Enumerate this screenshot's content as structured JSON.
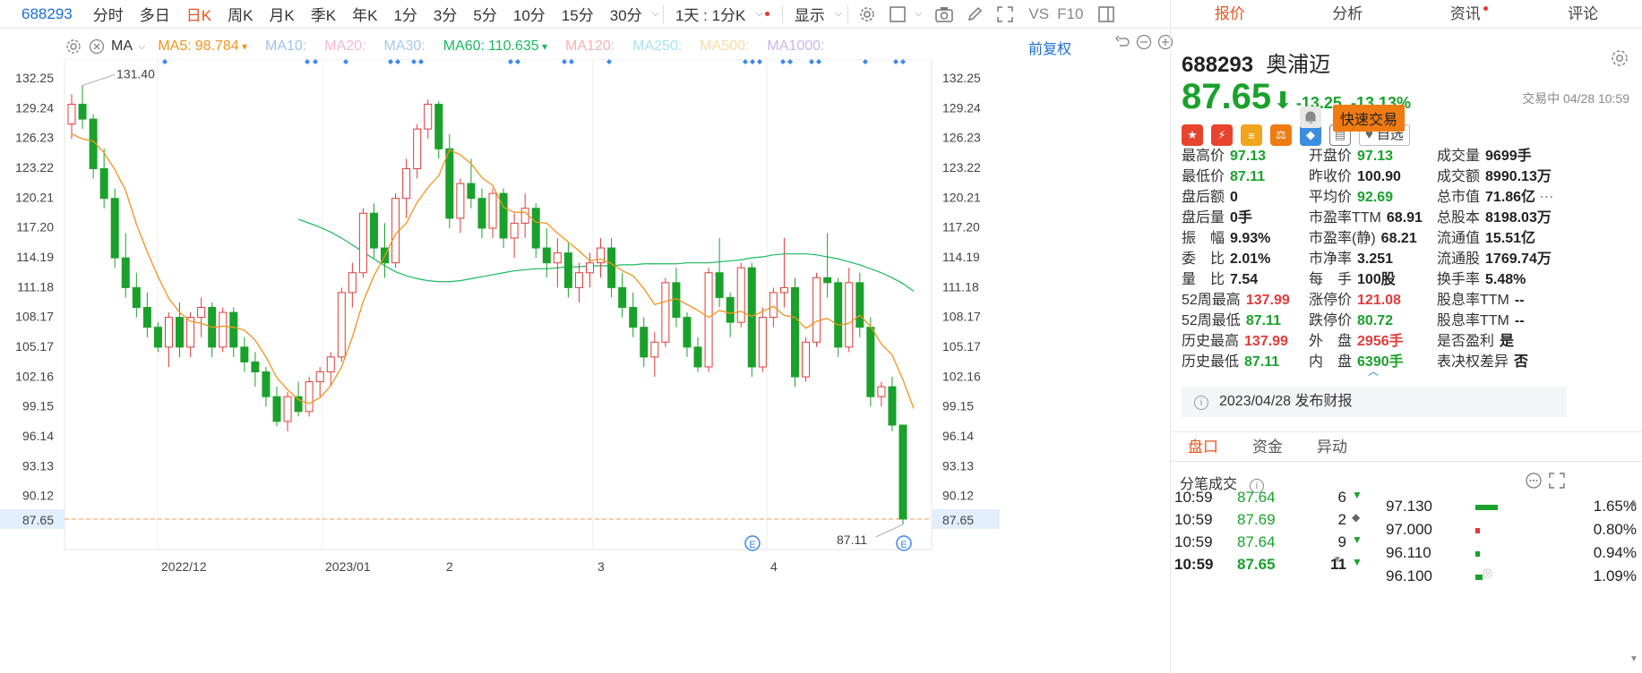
{
  "toolbar": {
    "code": "688293",
    "periods": [
      "分时",
      "多日",
      "日K",
      "周K",
      "月K",
      "季K",
      "年K",
      "1分",
      "3分",
      "5分",
      "10分",
      "15分",
      "30分"
    ],
    "active_period": "日K",
    "range": "1天 : 1分K",
    "display": "显示",
    "vs": "VS",
    "f10": "F10"
  },
  "ma_bar": {
    "indicator": "MA",
    "items": [
      {
        "label": "MA5:",
        "value": "98.784",
        "color": "#f0941c"
      },
      {
        "label": "MA10:",
        "value": "",
        "color": "#9cc3f0"
      },
      {
        "label": "MA20:",
        "value": "",
        "color": "#f6b7cf"
      },
      {
        "label": "MA30:",
        "value": "",
        "color": "#a8c8f0"
      },
      {
        "label": "MA60:",
        "value": "110.635",
        "color": "#1bb85f"
      },
      {
        "label": "MA120:",
        "value": "",
        "color": "#f5b2b2"
      },
      {
        "label": "MA250:",
        "value": "",
        "color": "#a6e3f2"
      },
      {
        "label": "MA500:",
        "value": "",
        "color": "#f6dca2"
      },
      {
        "label": "MA1000:",
        "value": "",
        "color": "#c9b5ea"
      }
    ],
    "fuquan": "前复权"
  },
  "chart_data": {
    "type": "candlestick",
    "y_ticks": [
      "132.25",
      "129.24",
      "126.23",
      "123.22",
      "120.21",
      "117.20",
      "114.19",
      "111.18",
      "108.17",
      "105.17",
      "102.16",
      "99.15",
      "96.14",
      "93.13",
      "90.12",
      "87.65"
    ],
    "ylim": [
      87.65,
      132.25
    ],
    "x_labels": [
      "2022/12",
      "2023/01",
      "2",
      "3",
      "4"
    ],
    "last_price": "87.65",
    "high_annotation": "131.40",
    "low_annotation": "87.11",
    "candles": [
      [
        127.5,
        130.5,
        126.0,
        129.5
      ],
      [
        129.5,
        131.4,
        127.0,
        128.0
      ],
      [
        128.0,
        128.5,
        122.0,
        123.0
      ],
      [
        123.0,
        125.0,
        119.0,
        120.0
      ],
      [
        120.0,
        121.0,
        113.0,
        114.0
      ],
      [
        114.0,
        116.5,
        110.0,
        111.0
      ],
      [
        111.0,
        112.5,
        108.0,
        109.0
      ],
      [
        109.0,
        110.5,
        106.0,
        107.0
      ],
      [
        107.0,
        107.5,
        104.5,
        105.0
      ],
      [
        105.0,
        108.5,
        103.0,
        108.0
      ],
      [
        108.0,
        109.5,
        104.0,
        105.0
      ],
      [
        105.0,
        108.5,
        104.0,
        108.0
      ],
      [
        108.0,
        110.0,
        106.0,
        109.0
      ],
      [
        109.0,
        109.5,
        104.0,
        105.0
      ],
      [
        105.0,
        109.0,
        104.5,
        108.5
      ],
      [
        108.5,
        109.0,
        104.0,
        105.0
      ],
      [
        105.0,
        106.0,
        102.5,
        103.5
      ],
      [
        103.5,
        104.5,
        101.0,
        102.5
      ],
      [
        102.5,
        103.0,
        99.0,
        100.0
      ],
      [
        100.0,
        101.0,
        97.0,
        97.5
      ],
      [
        97.5,
        100.5,
        96.5,
        100.0
      ],
      [
        100.0,
        101.5,
        98.0,
        98.5
      ],
      [
        98.5,
        102.0,
        98.0,
        101.5
      ],
      [
        101.5,
        103.0,
        100.0,
        102.5
      ],
      [
        102.5,
        104.5,
        101.0,
        104.0
      ],
      [
        104.0,
        111.0,
        103.5,
        110.5
      ],
      [
        110.5,
        113.5,
        109.0,
        112.5
      ],
      [
        112.5,
        119.0,
        112.0,
        118.5
      ],
      [
        118.5,
        119.5,
        114.0,
        115.0
      ],
      [
        115.0,
        117.5,
        112.0,
        113.5
      ],
      [
        113.5,
        120.5,
        113.0,
        120.0
      ],
      [
        120.0,
        124.0,
        118.0,
        123.0
      ],
      [
        123.0,
        127.5,
        122.0,
        127.0
      ],
      [
        127.0,
        130.0,
        126.0,
        129.5
      ],
      [
        129.5,
        129.8,
        124.0,
        125.0
      ],
      [
        125.0,
        126.5,
        117.0,
        118.0
      ],
      [
        118.0,
        122.0,
        116.5,
        121.5
      ],
      [
        121.5,
        124.0,
        119.0,
        120.0
      ],
      [
        120.0,
        121.0,
        116.0,
        117.0
      ],
      [
        117.0,
        121.0,
        116.0,
        120.5
      ],
      [
        120.5,
        121.0,
        115.0,
        116.0
      ],
      [
        116.0,
        118.5,
        114.0,
        117.5
      ],
      [
        117.5,
        120.5,
        116.0,
        119.0
      ],
      [
        119.0,
        119.5,
        114.0,
        115.0
      ],
      [
        115.0,
        117.0,
        112.0,
        113.5
      ],
      [
        113.5,
        116.0,
        111.0,
        114.5
      ],
      [
        114.5,
        115.5,
        110.0,
        111.0
      ],
      [
        111.0,
        113.5,
        109.5,
        112.5
      ],
      [
        112.5,
        114.5,
        111.0,
        113.5
      ],
      [
        113.5,
        116.0,
        112.0,
        115.0
      ],
      [
        115.0,
        116.0,
        110.0,
        111.0
      ],
      [
        111.0,
        112.5,
        108.0,
        109.0
      ],
      [
        109.0,
        110.5,
        106.0,
        107.0
      ],
      [
        107.0,
        108.0,
        103.0,
        104.0
      ],
      [
        104.0,
        106.5,
        102.0,
        105.5
      ],
      [
        105.5,
        112.0,
        105.0,
        111.5
      ],
      [
        111.5,
        113.0,
        107.0,
        108.0
      ],
      [
        108.0,
        108.5,
        104.0,
        105.0
      ],
      [
        105.0,
        106.0,
        102.5,
        103.0
      ],
      [
        103.0,
        113.0,
        102.5,
        112.5
      ],
      [
        112.5,
        116.0,
        109.0,
        110.0
      ],
      [
        110.0,
        110.5,
        106.0,
        107.5
      ],
      [
        107.5,
        113.5,
        107.0,
        113.0
      ],
      [
        113.0,
        113.5,
        102.0,
        103.0
      ],
      [
        103.0,
        109.0,
        102.5,
        108.0
      ],
      [
        108.0,
        111.0,
        107.0,
        110.5
      ],
      [
        110.5,
        116.0,
        109.0,
        111.0
      ],
      [
        111.0,
        112.0,
        101.0,
        102.0
      ],
      [
        102.0,
        106.0,
        101.5,
        105.5
      ],
      [
        105.5,
        112.5,
        105.0,
        112.0
      ],
      [
        112.0,
        116.5,
        110.0,
        111.5
      ],
      [
        111.5,
        112.0,
        104.0,
        105.0
      ],
      [
        105.0,
        113.0,
        104.5,
        111.5
      ],
      [
        111.5,
        112.5,
        106.0,
        107.0
      ],
      [
        107.0,
        108.0,
        99.0,
        100.0
      ],
      [
        100.0,
        101.5,
        99.0,
        101.0
      ],
      [
        101.0,
        102.0,
        96.5,
        97.13
      ],
      [
        97.13,
        97.13,
        87.11,
        87.65
      ]
    ],
    "ma5": [
      126.5,
      126.0,
      125.8,
      124.6,
      122.9,
      120.8,
      117.4,
      114.6,
      112.1,
      109.9,
      108.5,
      107.6,
      107.4,
      107.0,
      107.1,
      107.0,
      106.7,
      105.7,
      104.0,
      101.9,
      100.7,
      99.7,
      99.3,
      99.9,
      101.1,
      103.0,
      106.0,
      109.6,
      112.2,
      114.2,
      116.4,
      117.5,
      119.6,
      121.1,
      122.3,
      124.9,
      124.4,
      123.5,
      122.1,
      121.3,
      119.1,
      118.6,
      118.6,
      117.6,
      117.5,
      116.5,
      115.6,
      114.7,
      113.7,
      113.9,
      113.4,
      112.7,
      112.2,
      110.9,
      109.3,
      109.6,
      109.9,
      109.3,
      108.7,
      108.0,
      108.7,
      108.4,
      108.6,
      108.1,
      108.6,
      109.1,
      108.2,
      108.0,
      106.9,
      107.6,
      107.9,
      107.2,
      107.4,
      108.2,
      107.1,
      105.3,
      104.2,
      101.7,
      98.8
    ],
    "ma60": [
      null,
      null,
      null,
      null,
      null,
      null,
      null,
      null,
      null,
      null,
      null,
      null,
      null,
      null,
      null,
      null,
      null,
      null,
      null,
      null,
      null,
      117.9,
      117.5,
      117.1,
      116.6,
      116.0,
      115.3,
      114.6,
      113.9,
      113.2,
      112.6,
      112.2,
      111.9,
      111.7,
      111.6,
      111.6,
      111.7,
      111.9,
      112.1,
      112.3,
      112.5,
      112.7,
      112.8,
      112.9,
      112.9,
      113.0,
      113.1,
      113.1,
      113.2,
      113.2,
      113.2,
      113.3,
      113.3,
      113.4,
      113.4,
      113.4,
      113.4,
      113.5,
      113.5,
      113.5,
      113.6,
      113.7,
      113.8,
      114.0,
      114.1,
      114.3,
      114.4,
      114.4,
      114.4,
      114.3,
      114.1,
      113.9,
      113.6,
      113.3,
      112.9,
      112.5,
      112.0,
      111.4,
      110.635
    ]
  },
  "quote": {
    "tabs": [
      "报价",
      "分析",
      "资讯",
      "评论"
    ],
    "code": "688293",
    "name": "奥浦迈",
    "price": "87.65",
    "change": "-13.25",
    "change_pct": "-13.13%",
    "trade_status": "交易中 04/28 10:59",
    "zixuan": "自选",
    "quick_trade": "快速交易",
    "fields": [
      {
        "label": "最高价",
        "value": "97.13",
        "color": "#1aa12b"
      },
      {
        "label": "最低价",
        "value": "87.11",
        "color": "#1aa12b"
      },
      {
        "label": "盘后额",
        "value": "0",
        "color": "#222"
      },
      {
        "label": "盘后量",
        "value": "0手",
        "color": "#222"
      },
      {
        "label": "振　幅",
        "value": "9.93%",
        "color": "#222"
      },
      {
        "label": "委　比",
        "value": "2.01%",
        "color": "#222"
      },
      {
        "label": "量　比",
        "value": "7.54",
        "color": "#222"
      },
      {
        "label": "52周最高",
        "value": "137.99",
        "color": "#e23b3b"
      },
      {
        "label": "52周最低",
        "value": "87.11",
        "color": "#1aa12b"
      },
      {
        "label": "历史最高",
        "value": "137.99",
        "color": "#e23b3b"
      },
      {
        "label": "历史最低",
        "value": "87.11",
        "color": "#1aa12b"
      },
      {
        "label": "开盘价",
        "value": "97.13",
        "color": "#1aa12b"
      },
      {
        "label": "昨收价",
        "value": "100.90",
        "color": "#222"
      },
      {
        "label": "平均价",
        "value": "92.69",
        "color": "#1aa12b"
      },
      {
        "label": "市盈率TTM",
        "value": "68.91",
        "color": "#222"
      },
      {
        "label": "市盈率(静)",
        "value": "68.21",
        "color": "#222"
      },
      {
        "label": "市净率",
        "value": "3.251",
        "color": "#222"
      },
      {
        "label": "每　手",
        "value": "100股",
        "color": "#222"
      },
      {
        "label": "涨停价",
        "value": "121.08",
        "color": "#e23b3b"
      },
      {
        "label": "跌停价",
        "value": "80.72",
        "color": "#1aa12b"
      },
      {
        "label": "外　盘",
        "value": "2956手",
        "color": "#e23b3b"
      },
      {
        "label": "内　盘",
        "value": "6390手",
        "color": "#1aa12b"
      },
      {
        "label": "成交量",
        "value": "9699手",
        "color": "#222"
      },
      {
        "label": "成交额",
        "value": "8990.13万",
        "color": "#222"
      },
      {
        "label": "总市值",
        "value": "71.86亿",
        "color": "#222"
      },
      {
        "label": "总股本",
        "value": "8198.03万",
        "color": "#222"
      },
      {
        "label": "流通值",
        "value": "15.51亿",
        "color": "#222"
      },
      {
        "label": "流通股",
        "value": "1769.74万",
        "color": "#222"
      },
      {
        "label": "换手率",
        "value": "5.48%",
        "color": "#222"
      },
      {
        "label": "股息率TTM",
        "value": "--",
        "color": "#222"
      },
      {
        "label": "股息率TTM",
        "value": "--",
        "color": "#222"
      },
      {
        "label": "是否盈利",
        "value": "是",
        "color": "#222"
      },
      {
        "label": "表决权差异",
        "value": "否",
        "color": "#222"
      }
    ],
    "report": "2023/04/28  发布财报"
  },
  "panel": {
    "tabs": [
      "盘口",
      "资金",
      "异动"
    ],
    "fenbi_title": "分笔成交",
    "ticks": [
      {
        "time": "10:59",
        "price": "87.64",
        "vol": "6",
        "dir": "down"
      },
      {
        "time": "10:59",
        "price": "87.69",
        "vol": "2",
        "dir": "flat"
      },
      {
        "time": "10:59",
        "price": "87.64",
        "vol": "9",
        "dir": "down"
      },
      {
        "time": "10:59",
        "price": "87.65",
        "vol": "11",
        "dir": "down"
      }
    ],
    "dist": [
      {
        "price": "97.130",
        "pct": "1.65%",
        "bar": 0.55,
        "color": "#1aa12b"
      },
      {
        "price": "97.000",
        "pct": "0.80%",
        "bar": 0.12,
        "color": "#e23b3b"
      },
      {
        "price": "96.110",
        "pct": "0.94%",
        "bar": 0.12,
        "color": "#1aa12b"
      },
      {
        "price": "96.100",
        "pct": "1.09%",
        "bar": 0.18,
        "color": "#1aa12b"
      }
    ]
  }
}
